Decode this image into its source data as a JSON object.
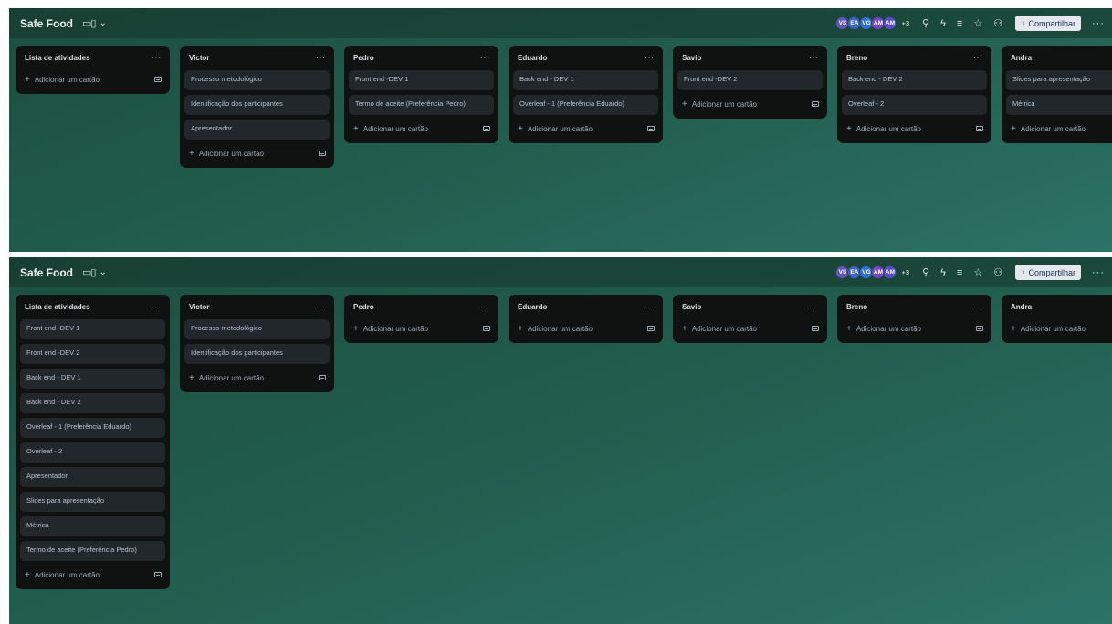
{
  "boards": [
    {
      "title": "Safe Food",
      "avatars": [
        {
          "initials": "VS",
          "color": "#6554c0"
        },
        {
          "initials": "EA",
          "color": "#3d63c8"
        },
        {
          "initials": "VG",
          "color": "#2f6fd6"
        },
        {
          "initials": "AM",
          "color": "#7a44c8"
        },
        {
          "initials": "AM",
          "color": "#5a4bd1"
        }
      ],
      "more_members": "+3",
      "share_label": "Compartilhar",
      "lists": [
        {
          "title": "Lista de atividades",
          "cards": [],
          "add_label": "Adicionar um cartão"
        },
        {
          "title": "Victor",
          "cards": [
            "Processo metodológico",
            "Identificação dos participantes",
            "Apresentador"
          ],
          "add_label": "Adicionar um cartão"
        },
        {
          "title": "Pedro",
          "cards": [
            "Front end -DEV 1",
            "Termo de aceite (Preferência Pedro)"
          ],
          "add_label": "Adicionar um cartão"
        },
        {
          "title": "Eduardo",
          "cards": [
            "Back end - DEV 1",
            "Overleaf - 1 (Preferência Eduardo)"
          ],
          "add_label": "Adicionar um cartão"
        },
        {
          "title": "Savio",
          "cards": [
            "Front end -DEV 2"
          ],
          "add_label": "Adicionar um cartão"
        },
        {
          "title": "Breno",
          "cards": [
            "Back end - DEV 2",
            "Overleaf - 2"
          ],
          "add_label": "Adicionar um cartão"
        },
        {
          "title": "Andra",
          "cards": [
            "Slides para apresentação",
            "Métrica"
          ],
          "add_label": "Adicionar um cartão"
        }
      ]
    },
    {
      "title": "Safe Food",
      "avatars": [
        {
          "initials": "VS",
          "color": "#6554c0"
        },
        {
          "initials": "EA",
          "color": "#3d63c8"
        },
        {
          "initials": "VG",
          "color": "#2f6fd6"
        },
        {
          "initials": "AM",
          "color": "#7a44c8"
        },
        {
          "initials": "AM",
          "color": "#5a4bd1"
        }
      ],
      "more_members": "+3",
      "share_label": "Compartilhar",
      "lists": [
        {
          "title": "Lista de atividades",
          "cards": [
            "Front end -DEV 1",
            "Front end -DEV 2",
            "Back end - DEV 1",
            "Back end - DEV 2",
            "Overleaf - 1 (Preferência Eduardo)",
            "Overleaf - 2",
            "Apresentador",
            "Slides para apresentação",
            "Métrica",
            "Termo de aceite (Preferência Pedro)"
          ],
          "add_label": "Adicionar um cartão"
        },
        {
          "title": "Victor",
          "cards": [
            "Processo metodológico",
            "Identificação dos participantes"
          ],
          "add_label": "Adicionar um cartão"
        },
        {
          "title": "Pedro",
          "cards": [],
          "add_label": "Adicionar um cartão"
        },
        {
          "title": "Eduardo",
          "cards": [],
          "add_label": "Adicionar um cartão"
        },
        {
          "title": "Savio",
          "cards": [],
          "add_label": "Adicionar um cartão"
        },
        {
          "title": "Breno",
          "cards": [],
          "add_label": "Adicionar um cartão"
        },
        {
          "title": "Andra",
          "cards": [],
          "add_label": "Adicionar um cartão"
        }
      ]
    }
  ],
  "icons": {
    "view": "board-view-icon",
    "pin": "pin-icon",
    "automation": "lightning-icon",
    "filter": "filter-icon",
    "star": "star-icon",
    "visibility": "people-icon",
    "share": "add-person-icon",
    "more": "ellipsis-icon"
  }
}
